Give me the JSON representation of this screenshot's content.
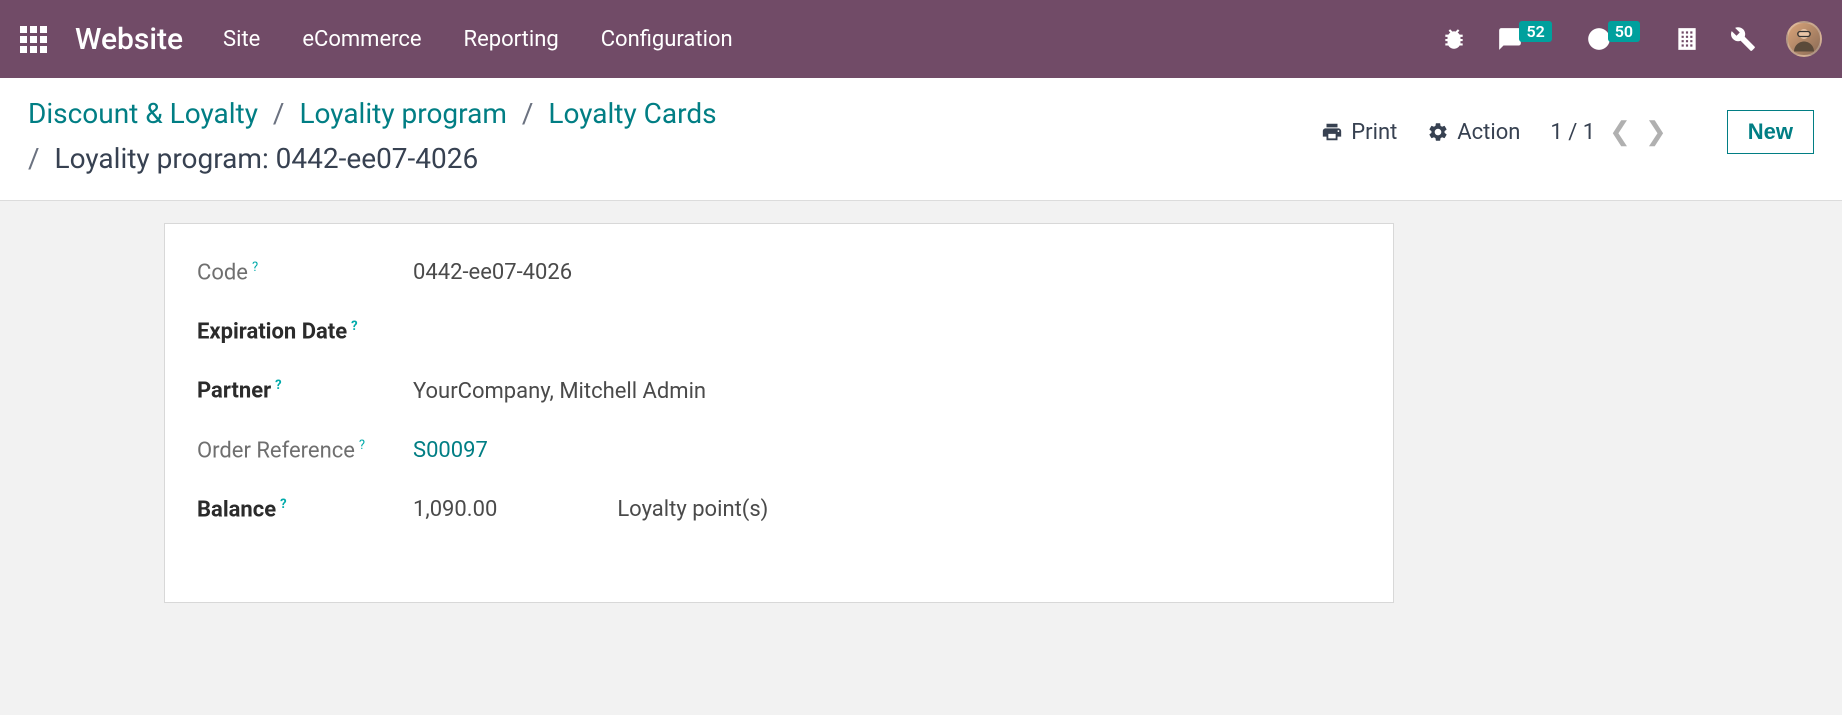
{
  "navbar": {
    "brand": "Website",
    "menu": [
      "Site",
      "eCommerce",
      "Reporting",
      "Configuration"
    ],
    "badges": {
      "messages": "52",
      "activities": "50"
    }
  },
  "breadcrumb": {
    "items": [
      "Discount & Loyalty",
      "Loyality program",
      "Loyalty Cards"
    ],
    "current": "Loyality program: 0442-ee07-4026"
  },
  "actions": {
    "print": "Print",
    "action": "Action",
    "pager": "1 / 1",
    "new": "New"
  },
  "form": {
    "fields": {
      "code": {
        "label": "Code",
        "value": "0442-ee07-4026"
      },
      "expiration": {
        "label": "Expiration Date",
        "value": ""
      },
      "partner": {
        "label": "Partner",
        "value": "YourCompany, Mitchell Admin"
      },
      "order_ref": {
        "label": "Order Reference",
        "value": "S00097"
      },
      "balance": {
        "label": "Balance",
        "value": "1,090.00",
        "unit": "Loyalty point(s)"
      }
    }
  }
}
